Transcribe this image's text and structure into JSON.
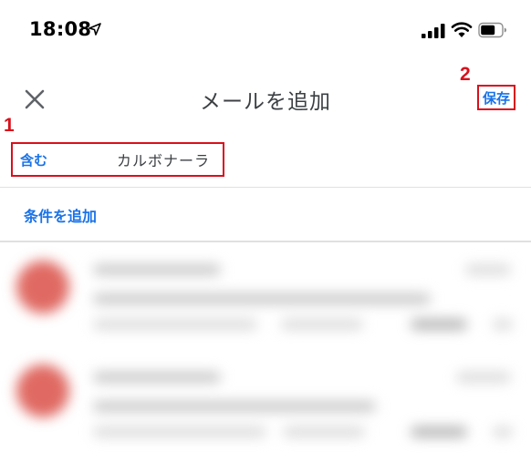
{
  "status_bar": {
    "time": "18:08",
    "icons": [
      "location-arrow-icon",
      "signal-icon",
      "wifi-icon",
      "battery-icon"
    ]
  },
  "app_bar": {
    "close_icon": "close-icon",
    "title": "メールを追加",
    "save_label": "保存"
  },
  "filter": {
    "condition_type": "含む",
    "condition_value": "カルボナーラ",
    "add_condition_label": "条件を追加"
  },
  "annotations": {
    "callout_1": "1",
    "callout_2": "2"
  },
  "colors": {
    "accent_blue": "#1a73e8",
    "annotation_red": "#d8101c",
    "avatar_red": "#e06a63",
    "divider": "#e0e0e0"
  }
}
